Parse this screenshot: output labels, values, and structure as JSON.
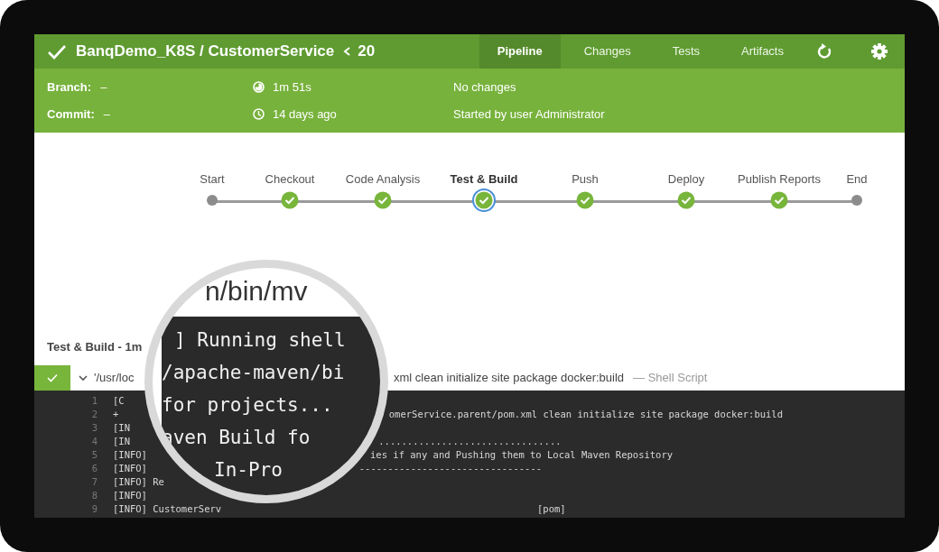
{
  "header": {
    "title": "BanqDemo_K8S / CustomerService",
    "run_number": "20",
    "tabs": [
      {
        "label": "Pipeline",
        "selected": true
      },
      {
        "label": "Changes",
        "selected": false
      },
      {
        "label": "Tests",
        "selected": false
      },
      {
        "label": "Artifacts",
        "selected": false
      }
    ]
  },
  "info": {
    "branch_label": "Branch:",
    "branch": "–",
    "commit_label": "Commit:",
    "commit": "–",
    "duration": "1m 51s",
    "started_ago": "14 days ago",
    "changes": "No changes",
    "cause": "Started by user Administrator"
  },
  "stages": [
    {
      "label": "Start",
      "kind": "terminal",
      "selected": false
    },
    {
      "label": "Checkout",
      "kind": "passed",
      "selected": false
    },
    {
      "label": "Code Analysis",
      "kind": "passed",
      "selected": false
    },
    {
      "label": "Test & Build",
      "kind": "passed",
      "selected": true
    },
    {
      "label": "Push",
      "kind": "passed",
      "selected": false
    },
    {
      "label": "Deploy",
      "kind": "passed",
      "selected": false
    },
    {
      "label": "Publish Reports",
      "kind": "passed",
      "selected": false
    },
    {
      "label": "End",
      "kind": "terminal",
      "selected": false
    }
  ],
  "step_section": {
    "title": "Test & Build - 1m",
    "step": {
      "expanded": true,
      "command_start": "'/usr/loc",
      "command_end": "xml clean initialize site package docker:build",
      "type": "— Shell Script"
    }
  },
  "log": [
    {
      "number": "1",
      "left": "[C"
    },
    {
      "number": "2",
      "left": "+",
      "right": "omerService.parent/pom.xml clean initialize site package docker:build"
    },
    {
      "number": "3",
      "left": "[IN"
    },
    {
      "number": "4",
      "left": "[IN",
      "right": "................................"
    },
    {
      "number": "5",
      "left": "[INFO]",
      "right": "ies if any and Pushing them to Local Maven Repository"
    },
    {
      "number": "6",
      "left": "[INFO]",
      "right": "--------------------------------"
    },
    {
      "number": "7",
      "left": "[INFO] Re"
    },
    {
      "number": "8",
      "left": "[INFO]"
    },
    {
      "number": "9",
      "left": "[INFO] CustomerServ",
      "right": "[pom]"
    }
  ],
  "magnifier": {
    "heading": "n/bin/mv",
    "lines": [
      "] Running shell",
      "/apache-maven/bi",
      "for projects...",
      "aven Build fo",
      "In-Pro"
    ]
  }
}
